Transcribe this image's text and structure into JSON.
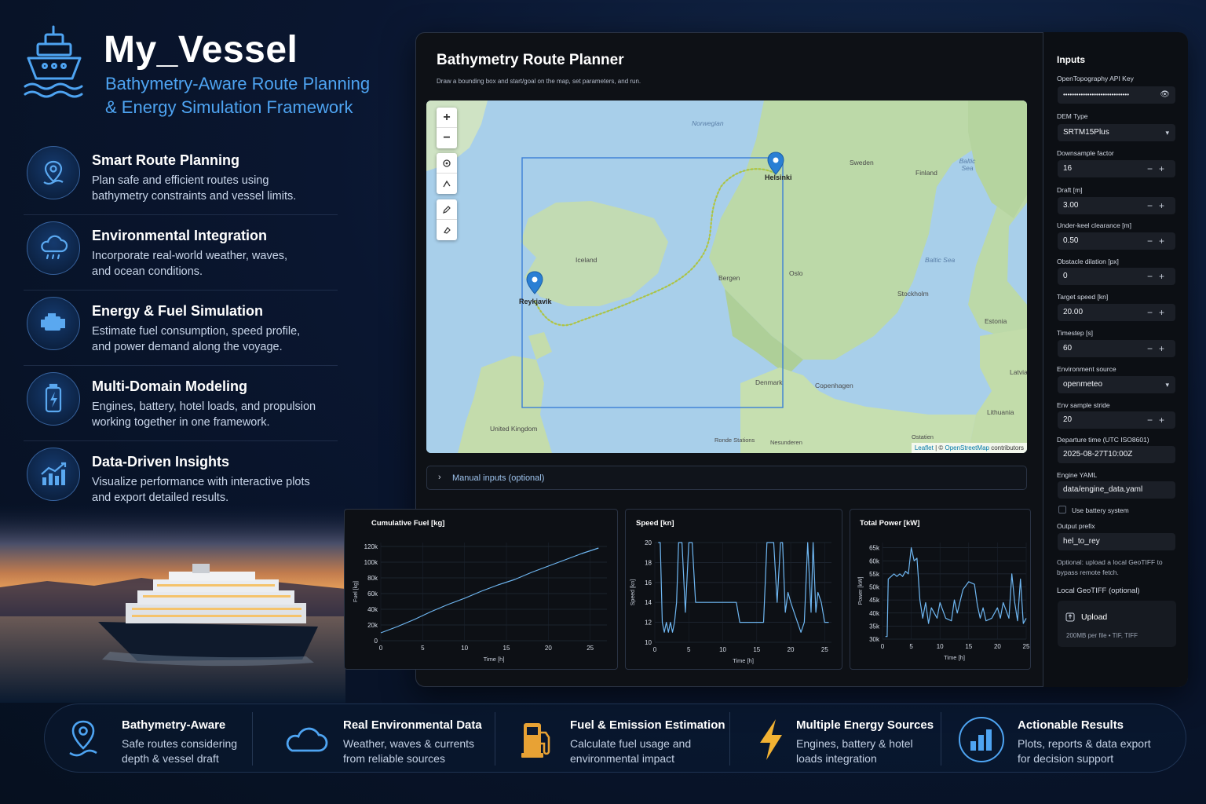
{
  "brand": {
    "title": "My_Vessel",
    "subtitle_line1": "Bathymetry-Aware Route Planning",
    "subtitle_line2": "& Energy Simulation Framework"
  },
  "features": [
    {
      "icon": "location-pin-icon",
      "title": "Smart Route Planning",
      "desc1": "Plan safe and efficient routes using",
      "desc2": "bathymetry constraints and vessel limits."
    },
    {
      "icon": "cloud-rain-icon",
      "title": "Environmental Integration",
      "desc1": "Incorporate real-world weather, waves,",
      "desc2": "and ocean conditions."
    },
    {
      "icon": "engine-icon",
      "title": "Energy & Fuel Simulation",
      "desc1": "Estimate fuel consumption, speed profile,",
      "desc2": "and power demand along the voyage."
    },
    {
      "icon": "battery-icon",
      "title": "Multi-Domain Modeling",
      "desc1": "Engines, battery, hotel loads, and propulsion",
      "desc2": "working together in one framework."
    },
    {
      "icon": "bar-chart-icon",
      "title": "Data-Driven Insights",
      "desc1": "Visualize performance with interactive plots",
      "desc2": "and export detailed results."
    }
  ],
  "app": {
    "title": "Bathymetry Route Planner",
    "hint": "Draw a bounding box and start/goal on the map, set parameters, and run.",
    "manual_inputs": "Manual inputs (optional)"
  },
  "map": {
    "zoom_in": "+",
    "zoom_out": "−",
    "labels": {
      "norwegian": "Norwegian",
      "sweden": "Sweden",
      "finland": "Finland",
      "baltic1": "Baltic Sea",
      "iceland": "Iceland",
      "bergen": "Bergen",
      "oslo": "Oslo",
      "baltic2": "Baltic Sea",
      "stockholm": "Stockholm",
      "estonia": "Estonia",
      "latvia": "Latvia",
      "denmark": "Denmark",
      "copenhagen": "Copenhagen",
      "lithuania": "Lithuania",
      "uk": "United Kingdom",
      "helsinki": "Helsinki",
      "reykjavik": "Reykjavik",
      "bottom1": "Ronde Stations",
      "bottom2": "Nesunderen",
      "bottom3": "Ostatien"
    },
    "attribution_leaflet": "Leaflet",
    "attribution_sep": " | © ",
    "attribution_osm": "OpenStreetMap",
    "attribution_rest": " contributors"
  },
  "inputs": {
    "title": "Inputs",
    "api_key_label": "OpenTopography API Key",
    "api_key_value": "••••••••••••••••••••••••••••••",
    "dem_label": "DEM Type",
    "dem_value": "SRTM15Plus",
    "downsample_label": "Downsample factor",
    "downsample_value": "16",
    "draft_label": "Draft [m]",
    "draft_value": "3.00",
    "ukc_label": "Under-keel clearance [m]",
    "ukc_value": "0.50",
    "dilation_label": "Obstacle dilation [px]",
    "dilation_value": "0",
    "speed_label": "Target speed [kn]",
    "speed_value": "20.00",
    "timestep_label": "Timestep [s]",
    "timestep_value": "60",
    "env_label": "Environment source",
    "env_value": "openmeteo",
    "stride_label": "Env sample stride",
    "stride_value": "20",
    "departure_label": "Departure time (UTC ISO8601)",
    "departure_value": "2025-08-27T10:00Z",
    "engine_label": "Engine YAML",
    "engine_value": "data/engine_data.yaml",
    "battery_label": "Use battery system",
    "battery_checked": false,
    "prefix_label": "Output prefix",
    "prefix_value": "hel_to_rey",
    "optional_note": "Optional: upload a local GeoTIFF to bypass remote fetch.",
    "geotiff_label": "Local GeoTIFF (optional)",
    "upload_label": "Upload",
    "upload_note": "200MB per file • TIF, TIFF"
  },
  "chart_data": [
    {
      "type": "line",
      "title": "Cumulative Fuel [kg]",
      "xlabel": "Time [h]",
      "ylabel": "Fuel [kg]",
      "xlim": [
        0,
        27
      ],
      "ylim": [
        0,
        125000
      ],
      "xticks": [
        0,
        5,
        10,
        15,
        20,
        25
      ],
      "yticks": [
        0,
        20000,
        40000,
        60000,
        80000,
        100000,
        120000
      ],
      "ytick_labels": [
        "0",
        "20k",
        "40k",
        "60k",
        "80k",
        "100k",
        "120k"
      ],
      "x": [
        0,
        2,
        4,
        6,
        8,
        10,
        12,
        14,
        16,
        18,
        20,
        22,
        24,
        26
      ],
      "y": [
        10000,
        18000,
        27000,
        37000,
        46000,
        54000,
        63000,
        71000,
        78000,
        87000,
        95000,
        103000,
        111000,
        118000
      ]
    },
    {
      "type": "line",
      "title": "Speed [kn]",
      "xlabel": "Time [h]",
      "ylabel": "Speed [kn]",
      "xlim": [
        0,
        26
      ],
      "ylim": [
        10,
        20
      ],
      "xticks": [
        0,
        5,
        10,
        15,
        20,
        25
      ],
      "yticks": [
        10,
        12,
        14,
        16,
        18,
        20
      ],
      "ytick_labels": [
        "10",
        "12",
        "14",
        "16",
        "18",
        "20"
      ],
      "x": [
        0.5,
        0.8,
        1.1,
        1.4,
        1.7,
        2.0,
        2.3,
        2.6,
        2.9,
        3.2,
        3.5,
        4.0,
        4.5,
        5.0,
        5.5,
        6.0,
        6.5,
        7.0,
        7.5,
        8.0,
        9.0,
        10.0,
        11.0,
        12.0,
        12.5,
        13.0,
        14.0,
        15.0,
        16.0,
        16.5,
        17.0,
        17.5,
        18.0,
        18.5,
        18.8,
        19.2,
        19.6,
        20.0,
        20.5,
        21.0,
        21.5,
        22.0,
        22.5,
        23.0,
        23.3,
        23.7,
        24.0,
        24.5,
        25.0,
        25.3,
        25.6
      ],
      "y": [
        20,
        20,
        12,
        11,
        12,
        11,
        12,
        11,
        12,
        14,
        20,
        20,
        13,
        20,
        20,
        14,
        14,
        14,
        14,
        14,
        14,
        14,
        14,
        14,
        12,
        12,
        12,
        12,
        12,
        20,
        20,
        20,
        14,
        20,
        20,
        13,
        15,
        14,
        13,
        12,
        11,
        12,
        20,
        13,
        20,
        13,
        15,
        14,
        12,
        12,
        12
      ]
    },
    {
      "type": "line",
      "title": "Total Power [kW]",
      "xlabel": "Time [h]",
      "ylabel": "Power [kW]",
      "xlim": [
        0,
        25
      ],
      "ylim": [
        30000,
        67000
      ],
      "xticks": [
        0,
        5,
        10,
        15,
        20,
        25
      ],
      "yticks": [
        30000,
        35000,
        40000,
        45000,
        50000,
        55000,
        60000,
        65000
      ],
      "ytick_labels": [
        "30k",
        "35k",
        "40k",
        "45k",
        "50k",
        "55k",
        "60k",
        "65k"
      ],
      "x": [
        0.5,
        0.8,
        1.0,
        1.5,
        2.0,
        2.5,
        3.0,
        3.5,
        4.0,
        4.5,
        5.0,
        5.5,
        6.0,
        6.5,
        7.0,
        7.5,
        8.0,
        8.5,
        9.0,
        9.5,
        10.0,
        11.0,
        12.0,
        12.5,
        13.0,
        14.0,
        15.0,
        16.0,
        16.5,
        17.0,
        17.5,
        18.0,
        19.0,
        20.0,
        20.5,
        21.0,
        21.5,
        22.0,
        22.5,
        23.0,
        23.5,
        24.0,
        24.5,
        25.0
      ],
      "y": [
        31000,
        31000,
        53000,
        54000,
        55000,
        54000,
        55000,
        54000,
        56000,
        55000,
        65000,
        60000,
        61000,
        45000,
        38000,
        44000,
        36000,
        42000,
        40000,
        38000,
        44000,
        38000,
        37000,
        45000,
        40000,
        49000,
        52000,
        51000,
        43000,
        38000,
        42000,
        37000,
        38000,
        42000,
        38000,
        44000,
        41000,
        38000,
        55000,
        44000,
        37000,
        53000,
        36000,
        38000
      ]
    }
  ],
  "benefits": [
    {
      "icon": "location-pin-icon",
      "title": "Bathymetry-Aware",
      "desc1": "Safe routes considering",
      "desc2": "depth & vessel draft"
    },
    {
      "icon": "cloud-icon",
      "title": "Real Environmental Data",
      "desc1": "Weather, waves & currents",
      "desc2": "from reliable sources"
    },
    {
      "icon": "fuel-pump-icon",
      "title": "Fuel & Emission Estimation",
      "desc1": "Calculate fuel usage and",
      "desc2": "environmental impact"
    },
    {
      "icon": "lightning-icon",
      "title": "Multiple Energy Sources",
      "desc1": "Engines, battery & hotel",
      "desc2": "loads integration"
    },
    {
      "icon": "bar-chart-icon",
      "title": "Actionable Results",
      "desc1": "Plots, reports & data export",
      "desc2": "for decision support"
    }
  ],
  "colors": {
    "accent": "#4ea4f2",
    "plot_line": "#6fb7f2",
    "route": "#d9c53a",
    "bbox": "#3b7fd6",
    "marker": "#2a7fd4"
  }
}
